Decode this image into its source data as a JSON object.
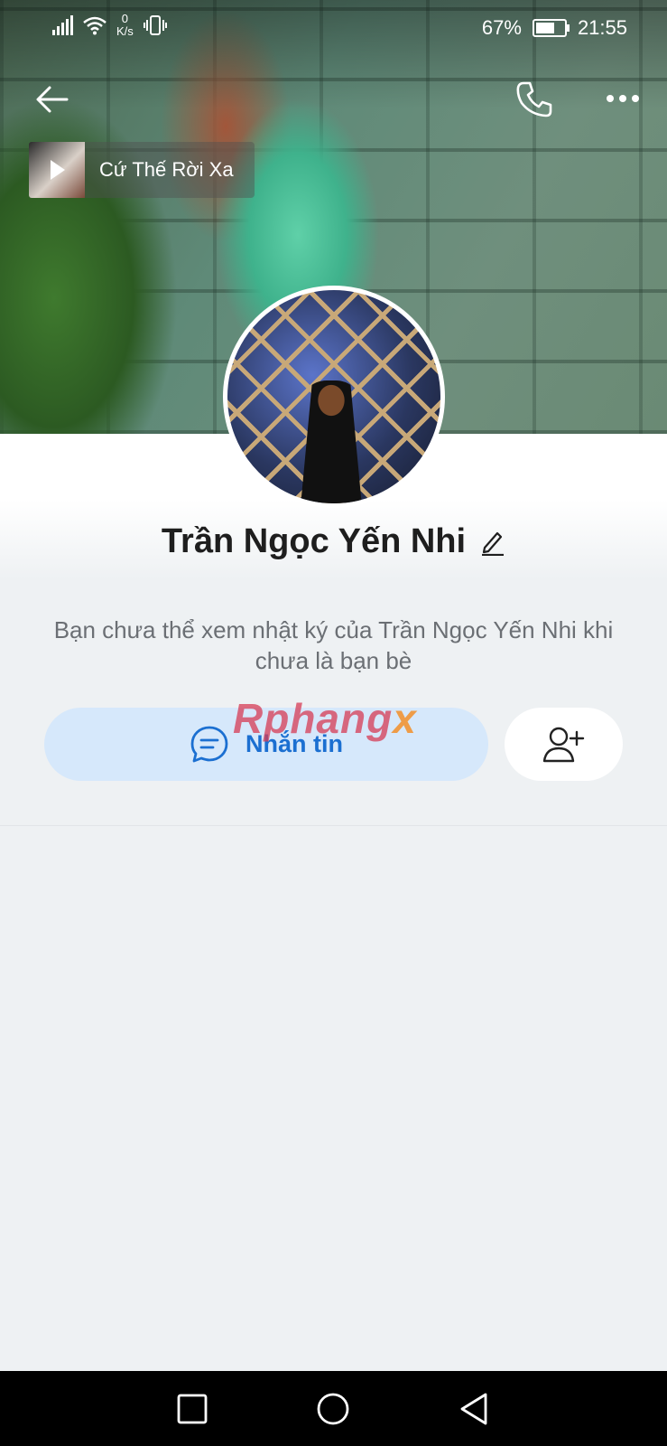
{
  "status_bar": {
    "net_speed_value": "0",
    "net_speed_unit": "K/s",
    "battery_percent": "67%",
    "time": "21:55",
    "icons": [
      "signal-icon",
      "wifi-icon",
      "vibrate-icon",
      "battery-icon"
    ]
  },
  "header": {
    "icons": [
      "back-arrow-icon",
      "phone-icon",
      "more-icon"
    ]
  },
  "music": {
    "title": "Cứ Thế Rời Xa",
    "icon": "play-icon"
  },
  "profile": {
    "name": "Trần Ngọc Yến Nhi",
    "edit_icon": "pencil-icon",
    "notice": "Bạn chưa thể xem nhật ký của Trần Ngọc Yến Nhi khi chưa là bạn bè"
  },
  "actions": {
    "message_label": "Nhắn tin",
    "message_icon": "chat-bubble-icon",
    "add_friend_icon": "add-friend-icon"
  },
  "watermark": {
    "part1": "Rphang",
    "part2": "x"
  },
  "nav_bar": {
    "icons": [
      "recent-apps-icon",
      "home-icon",
      "back-icon"
    ]
  },
  "colors": {
    "accent": "#1b6fd1",
    "message_button_bg": "#d6e8fb",
    "page_bg": "#eef1f3"
  }
}
